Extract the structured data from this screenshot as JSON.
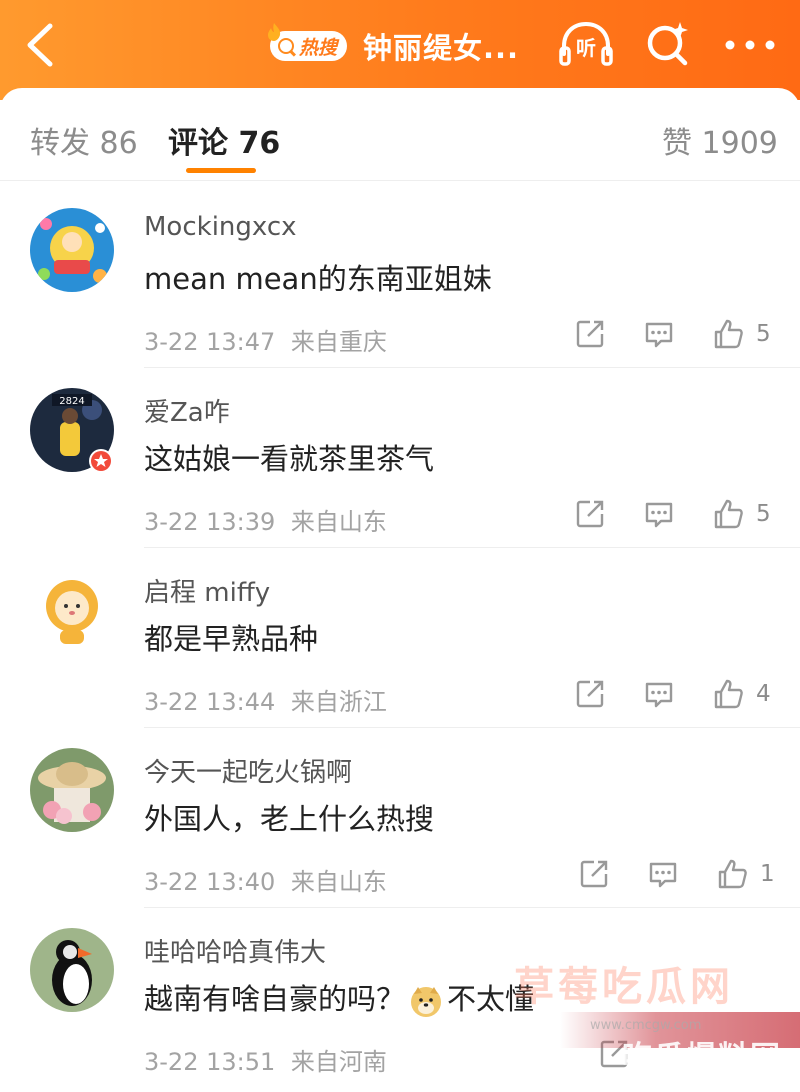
{
  "header": {
    "hot_label": "热搜",
    "title": "钟丽缇女...",
    "listen_label": "听",
    "colors": {
      "bg_start": "#ff9a2e",
      "bg_end": "#ff6a14"
    }
  },
  "tabs": [
    {
      "label": "转发 86"
    },
    {
      "label": "评论 76",
      "active": true
    },
    {
      "label": "赞 1909"
    }
  ],
  "comments": [
    {
      "name": "Mockingxcx",
      "text": "mean mean的东南亚姐妹",
      "time": "3-22 13:47",
      "source": "来自重庆",
      "likes": "5"
    },
    {
      "name": "爱Za咋",
      "text": "这姑娘一看就茶里茶气",
      "time": "3-22 13:39",
      "source": "来自山东",
      "likes": "5"
    },
    {
      "name": "启程 miffy",
      "text": "都是早熟品种",
      "time": "3-22 13:44",
      "source": "来自浙江",
      "likes": "4"
    },
    {
      "name": "今天一起吃火锅啊",
      "text": "外国人，老上什么热搜",
      "time": "3-22 13:40",
      "source": "来自山东",
      "likes": "1"
    },
    {
      "name": "哇哈哈哈真伟大",
      "text_before": "越南有啥自豪的吗？",
      "emoji": "doge-emoji",
      "text_after": "不太懂",
      "time": "3-22 13:51",
      "source": "来自河南",
      "likes": ""
    }
  ],
  "watermark": {
    "main": "草莓吃瓜网",
    "url": "www.cmcgw.com",
    "banner": "吃瓜爆料网"
  },
  "accent_color": "#ff8200"
}
